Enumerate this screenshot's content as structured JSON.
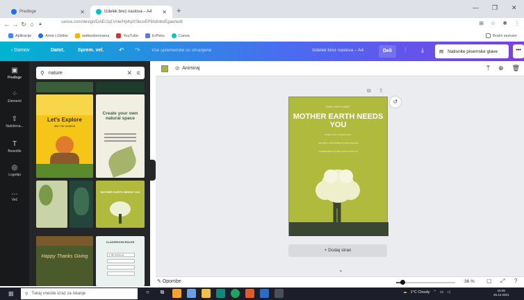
{
  "browser": {
    "tabs": [
      {
        "label": "Predloge"
      },
      {
        "label": "Izdelek brez naslova – A4"
      }
    ],
    "url": "canva.com/design/DAEr1q1Vnie/HpKpXSkcoEP6hdnboEgaw/edit",
    "bookmarks": [
      "Aplikacije",
      "Amie LGHbio",
      "wattwolamnanui",
      "YouTube",
      "ErPeks",
      "Canva"
    ],
    "reading_list": "Bralni seznam",
    "window_controls": [
      "—",
      "❐",
      "✕"
    ]
  },
  "canva": {
    "nav": {
      "home": "Domov",
      "file": "Datot.",
      "resize": "Sprem. vel.",
      "save_status": "Vse spremembe so shranjene",
      "doc_title": "Izdelek brez naslova – A4",
      "share": "Deli",
      "print": "Natisnite pisemske glave",
      "more": "•••"
    },
    "rail": [
      {
        "label": "Predloge",
        "icon": "templates-icon",
        "glyph": "▣"
      },
      {
        "label": "Elementi",
        "icon": "elements-icon",
        "glyph": "⁘"
      },
      {
        "label": "Naložena...",
        "icon": "upload-icon",
        "glyph": "⇧"
      },
      {
        "label": "Besedilo",
        "icon": "text-icon",
        "glyph": "T"
      },
      {
        "label": "Logotipi",
        "icon": "logo-icon",
        "glyph": "◎"
      },
      {
        "label": "Več",
        "icon": "more-icon",
        "glyph": "…"
      }
    ],
    "search": {
      "value": "nature"
    },
    "thumbnails": [
      {
        "title": "Let's Explore",
        "sub": "SEE THE UNSEEN"
      },
      {
        "title": "Create your own natural space",
        "sub": ""
      },
      {
        "title": "MOTHER EARTH NEEDS YOU",
        "sub": ""
      },
      {
        "title": "CLASSROOM RULES",
        "sub": "1. Be courteous"
      },
      {
        "title": "Happy Thanks Giving",
        "sub": ""
      }
    ],
    "toolbar": {
      "animate": "Animiraj"
    },
    "design": {
      "top_text": "SAVE OUR PLANET",
      "title": "MOTHER EARTH NEEDS YOU",
      "lines": [
        "EVERY DAY IS EARTH DAY",
        "PROTECT OUR FORESTS AND OCEANS",
        "A GREENER FUTURE STARTS WITH US"
      ]
    },
    "add_page": "+ Dodaj stran",
    "footer": {
      "notes": "Opombe",
      "zoom": "36 %",
      "zoom_fraction": 0.1
    }
  },
  "taskbar": {
    "search_placeholder": "Tukaj vnesite izraz za iskanje",
    "weather": "1°C Cloudy",
    "time": "15:05",
    "date": "26.12.2021"
  },
  "colors": {
    "design_bg": "#b0ba3c",
    "canva_gradient_start": "#00b4d0",
    "canva_gradient_end": "#7b3fe4"
  }
}
